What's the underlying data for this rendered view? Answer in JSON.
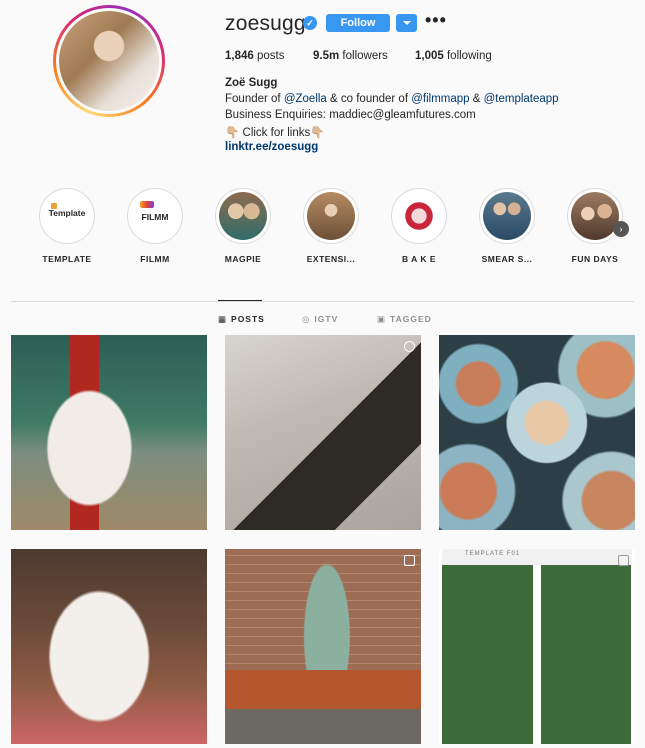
{
  "profile": {
    "username": "zoesugg",
    "follow_label": "Follow",
    "more_icon": "•••",
    "posts_count": "1,846",
    "posts_label": "posts",
    "followers_count": "9.5m",
    "followers_label": "followers",
    "following_count": "1,005",
    "following_label": "following",
    "full_name": "Zoë Sugg",
    "bio_line1_prefix": "Founder of ",
    "bio_line1_tag1": "@Zoella",
    "bio_line1_mid": " & co founder of ",
    "bio_line1_tag2": "@filmmapp",
    "bio_line1_amp": " & ",
    "bio_line1_tag3": "@templateapp",
    "bio_line2": "Business Enquiries: maddiec@gleamfutures.com",
    "bio_line3": "👇🏼 Click for links👇🏼",
    "link": "linktr.ee/zoesugg"
  },
  "highlights": [
    {
      "label": "TEMPLATE",
      "inner_text": "Template"
    },
    {
      "label": "FILMM",
      "inner_text": "FILMM"
    },
    {
      "label": "MAGPIE"
    },
    {
      "label": "EXTENSI..."
    },
    {
      "label": "B A K E"
    },
    {
      "label": "SMEAR S..."
    },
    {
      "label": "FUN DAYS"
    }
  ],
  "tabs": {
    "posts": "POSTS",
    "igtv": "IGTV",
    "tagged": "TAGGED"
  },
  "posts": {
    "post6_text": "TEMPLATE F01"
  },
  "colors": {
    "accent": "#3897f0",
    "link": "#00376b"
  }
}
